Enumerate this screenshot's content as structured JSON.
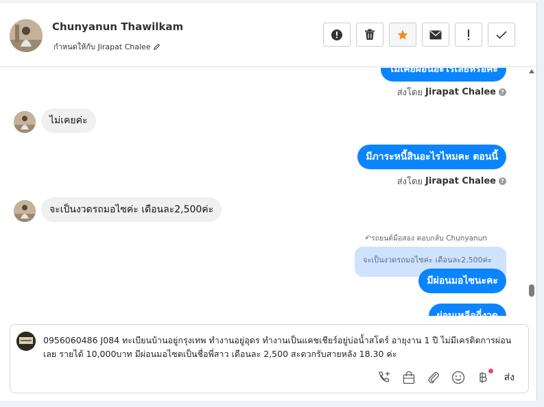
{
  "contact": {
    "name": "Chunyanun Thawilkam",
    "assigned_to": "กำหนดให้กับ Jirapat Chalee"
  },
  "toolbar": {
    "buttons": [
      "alert-circle-icon",
      "trash-icon",
      "star-icon",
      "envelope-icon",
      "exclamation-icon",
      "check-icon"
    ],
    "accent": "#f6891f"
  },
  "messages": {
    "m1_out_partial": "ไม่เคยผ่อนอะไรเลยหรือคะ",
    "m1_sent_by_prefix": "ส่งโดย",
    "m1_sent_by_name": "Jirapat Chalee",
    "m2_in": "ไม่เคยค่ะ",
    "m3_out": "มีภาระหนี้สินอะไรไหมคะ ตอนนี้",
    "m3_sent_by_prefix": "ส่งโดย",
    "m3_sent_by_name": "Jirapat Chalee",
    "m4_in": "จะเป็นงวดรถมอไซค่ะ เดือนละ2,500ค่ะ",
    "reply_meta": "↶รถยนต์มือสอง ตอบกลับ Chunyanun",
    "reply_quote": "จะเป็นงวดรถมอไซค่ะ เดือนละ2,500ค่ะ",
    "m5_out": "มีผ่อนมอไซนะคะ",
    "m6_out_partial": "ผ่อนเหลือกี่งวด"
  },
  "composer": {
    "text": "0956060486 J084 ทะเบียนบ้านอยู่กรุงเทพ ทำงานอยู่อุดร ทำงานเป็นแคชเชียร์อยู่บ่อน้ำสโตร์ อายุงาน 1 ปี ไม่มีเครดิตการผ่อนเลย รายได้ 10,000บาท มีผ่อนมอไซตเป็นชื่อพี่สาว เดือนละ 2,500 สะดวกรับสายหลัง 18.30 ค่ะ",
    "send_label": "ส่ง",
    "tools": [
      "phone-add-icon",
      "shopping-bag-icon",
      "paperclip-icon",
      "emoji-icon",
      "baht-icon"
    ]
  },
  "colors": {
    "outgoing": "#0a84ff",
    "incoming": "#f0f0f0",
    "quote": "#cfe3ff"
  }
}
